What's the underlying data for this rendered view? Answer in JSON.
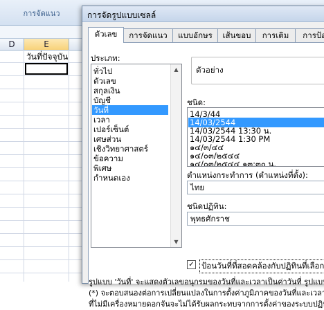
{
  "ribbon": {
    "group_label": "การจัดแนว"
  },
  "sheet": {
    "columns": [
      "D",
      "E",
      ""
    ],
    "selected_column": "E",
    "cell_e1": "วันที่ปัจจุบัน"
  },
  "dialog": {
    "title": "การจัดรูปแบบเซลล์",
    "tabs": [
      "ตัวเลข",
      "การจัดแนว",
      "แบบอักษร",
      "เส้นขอบ",
      "การเติม",
      "การป้อง"
    ],
    "active_tab": "ตัวเลข",
    "category_label": "ประเภท:",
    "categories": [
      "ทั่วไป",
      "ตัวเลข",
      "สกุลเงิน",
      "บัญชี",
      "วันที่",
      "เวลา",
      "เปอร์เซ็นต์",
      "เศษส่วน",
      "เชิงวิทยาศาสตร์",
      "ข้อความ",
      "พิเศษ",
      "กำหนดเอง"
    ],
    "selected_category": "วันที่",
    "sample_label": "ตัวอย่าง",
    "type_label": "ชนิด:",
    "types": [
      "14/3/44",
      "14/03/2544",
      "14/03/2544 13:30 น.",
      "14/03/2544 1:30 PM",
      "๑๔/๓/๔๔",
      "๑๔/๐๓/๒๕๔๔",
      "๑๔/๐๓/๒๕๔๔ ๑๓:๓๐ น."
    ],
    "selected_type": "14/03/2544",
    "locale_label": "ตำแหน่งกระทำการ (ตำแหน่งที่ตั้ง):",
    "locale_value": "ไทย",
    "calendar_label": "ชนิดปฏิทิน:",
    "calendar_value": "พุทธศักราช",
    "checkbox_label": "ป้อนวันที่ที่สอดคล้องกับปฏิทินที่เลือก",
    "checkbox_checked": true,
    "description_lines": [
      "รูปแบบ 'วันที่' จะแสดงตัวเลขอนุกรมของวันที่และเวลาเป็นค่าวันที่ รูปแบบ",
      "(*) จะตอบสนองต่อการเปลี่ยนแปลงในการตั้งค่าภูมิภาคของวันที่และเวลา",
      "ที่ไม่มีเครื่องหมายดอกจันจะไม่ได้รับผลกระทบจากการตั้งค่าของระบบปฏิบั"
    ]
  },
  "colors": {
    "selection": "#3399ff",
    "active_col_header": "#f8d27a",
    "border": "#8c9fb8"
  }
}
